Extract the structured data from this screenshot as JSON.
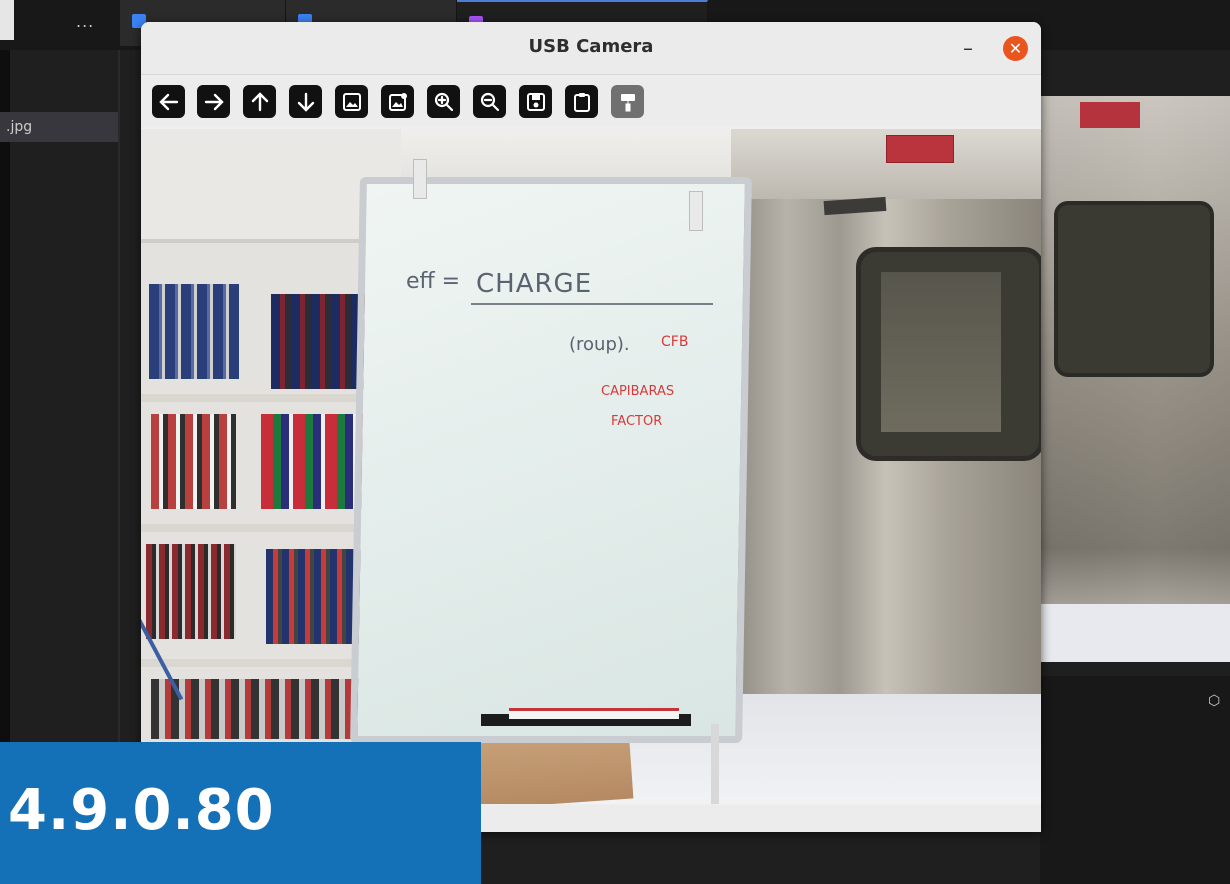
{
  "editor": {
    "ellipsis": "...",
    "file_label": ".jpg"
  },
  "window": {
    "title": "USB Camera",
    "minimize_glyph": "–",
    "close_glyph": "✕"
  },
  "toolbar": {
    "buttons": [
      {
        "name": "arrow-left-icon"
      },
      {
        "name": "arrow-right-icon"
      },
      {
        "name": "arrow-up-icon"
      },
      {
        "name": "arrow-down-icon"
      },
      {
        "name": "image-icon"
      },
      {
        "name": "image-settings-icon"
      },
      {
        "name": "zoom-in-icon"
      },
      {
        "name": "zoom-out-icon"
      },
      {
        "name": "save-icon"
      },
      {
        "name": "clipboard-icon"
      },
      {
        "name": "paint-roller-icon"
      }
    ]
  },
  "whiteboard": {
    "line1_left": "eff =",
    "line1_right": "CHARGE",
    "line2": "(roup).",
    "line2_red": "CFB",
    "red_line1": "CAPIBARAS",
    "red_line2": "FACTOR"
  },
  "version": {
    "text": "4.9.0.80"
  },
  "colors": {
    "accent": "#1471b8",
    "close": "#e9541f"
  }
}
